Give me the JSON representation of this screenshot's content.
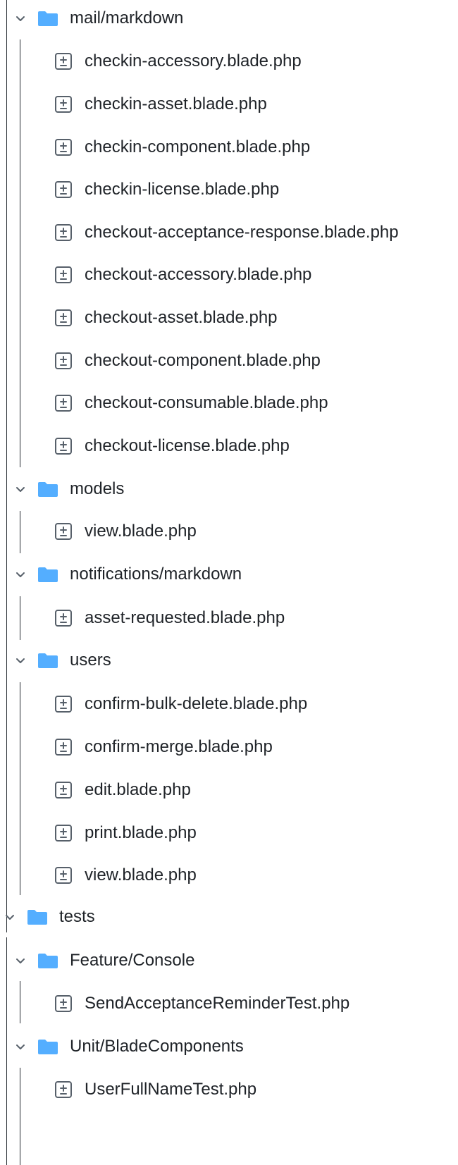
{
  "tree": {
    "icons": {
      "expand": "chevron-down-icon",
      "folder": "folder-icon",
      "file": "file-diff-icon"
    },
    "colors": {
      "folder": "#54aeff",
      "chevron": "#57606a",
      "file_icon": "#57606a",
      "guide": "#24292f"
    },
    "items": [
      {
        "type": "folder",
        "label": "mail/markdown",
        "expanded": true
      },
      {
        "type": "file",
        "label": "checkin-accessory.blade.php"
      },
      {
        "type": "file",
        "label": "checkin-asset.blade.php"
      },
      {
        "type": "file",
        "label": "checkin-component.blade.php"
      },
      {
        "type": "file",
        "label": "checkin-license.blade.php"
      },
      {
        "type": "file",
        "label": "checkout-acceptance-response.blade.php"
      },
      {
        "type": "file",
        "label": "checkout-accessory.blade.php"
      },
      {
        "type": "file",
        "label": "checkout-asset.blade.php"
      },
      {
        "type": "file",
        "label": "checkout-component.blade.php"
      },
      {
        "type": "file",
        "label": "checkout-consumable.blade.php"
      },
      {
        "type": "file",
        "label": "checkout-license.blade.php"
      },
      {
        "type": "folder",
        "label": "models",
        "expanded": true
      },
      {
        "type": "file",
        "label": "view.blade.php"
      },
      {
        "type": "folder",
        "label": "notifications/markdown",
        "expanded": true
      },
      {
        "type": "file",
        "label": "asset-requested.blade.php"
      },
      {
        "type": "folder",
        "label": "users",
        "expanded": true
      },
      {
        "type": "file",
        "label": "confirm-bulk-delete.blade.php"
      },
      {
        "type": "file",
        "label": "confirm-merge.blade.php"
      },
      {
        "type": "file",
        "label": "edit.blade.php"
      },
      {
        "type": "file",
        "label": "print.blade.php"
      },
      {
        "type": "file",
        "label": "view.blade.php"
      },
      {
        "type": "folder",
        "label": "tests",
        "expanded": true
      },
      {
        "type": "folder",
        "label": "Feature/Console",
        "expanded": true
      },
      {
        "type": "file",
        "label": "SendAcceptanceReminderTest.php"
      },
      {
        "type": "folder",
        "label": "Unit/BladeComponents",
        "expanded": true
      },
      {
        "type": "file",
        "label": "UserFullNameTest.php"
      }
    ]
  }
}
